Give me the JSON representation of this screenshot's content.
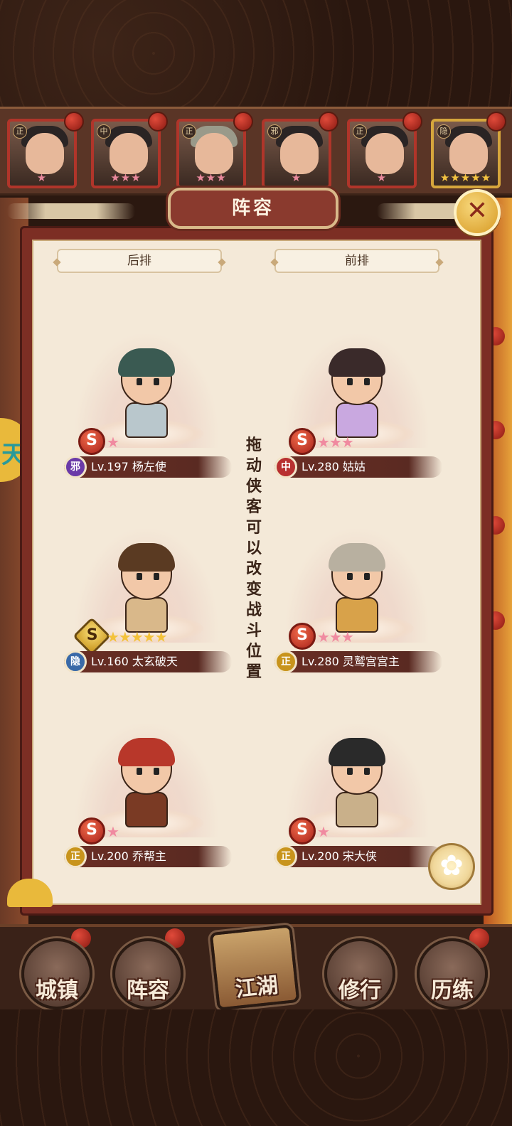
{
  "title": "阵容",
  "columns": {
    "back": "后排",
    "front": "前排"
  },
  "hint": "拖动侠客可以改变战斗位置",
  "roster_strip": [
    {
      "faction": "正",
      "stars": "★",
      "star_color": "pink"
    },
    {
      "faction": "中",
      "stars": "★★★",
      "star_color": "pink"
    },
    {
      "faction": "正",
      "stars": "★★★",
      "star_color": "pink"
    },
    {
      "faction": "邪",
      "stars": "★",
      "star_color": "pink"
    },
    {
      "faction": "正",
      "stars": "★",
      "star_color": "pink"
    },
    {
      "faction": "隐",
      "stars": "★★★★★",
      "star_color": "gold"
    }
  ],
  "heroes": [
    {
      "faction": "邪",
      "faction_color": "#6a3aa8",
      "level_name": "Lv.197 杨左使",
      "rank": "S",
      "rank_style": "red",
      "stars": "★",
      "star_color": "pink",
      "hair": "#3a5a52",
      "outfit": "#b9c7cc"
    },
    {
      "faction": "中",
      "faction_color": "#b83030",
      "level_name": "Lv.280 姑姑",
      "rank": "S",
      "rank_style": "red",
      "stars": "★★★",
      "star_color": "pink",
      "hair": "#3a2a2a",
      "outfit": "#c9a8e0"
    },
    {
      "faction": "隐",
      "faction_color": "#3a6aa8",
      "level_name": "Lv.160 太玄破天",
      "rank": "S",
      "rank_style": "gold",
      "stars": "★★★★★",
      "star_color": "gold",
      "hair": "#5a3a22",
      "outfit": "#d9b88a"
    },
    {
      "faction": "正",
      "faction_color": "#c8941c",
      "level_name": "Lv.280 灵鹫宫宫主",
      "rank": "S",
      "rank_style": "red",
      "stars": "★★★",
      "star_color": "pink",
      "hair": "#b8b0a0",
      "outfit": "#d8a24a"
    },
    {
      "faction": "正",
      "faction_color": "#c8941c",
      "level_name": "Lv.200 乔帮主",
      "rank": "S",
      "rank_style": "red",
      "stars": "★",
      "star_color": "pink",
      "hair": "#b8372a",
      "outfit": "#7a3a24"
    },
    {
      "faction": "正",
      "faction_color": "#c8941c",
      "level_name": "Lv.200 宋大侠",
      "rank": "S",
      "rank_style": "red",
      "stars": "★",
      "star_color": "pink",
      "hair": "#2a2a2a",
      "outfit": "#c9b08a"
    }
  ],
  "nav": [
    {
      "label": "城镇"
    },
    {
      "label": "阵容"
    },
    {
      "label": "江湖"
    },
    {
      "label": "修行"
    },
    {
      "label": "历练"
    }
  ],
  "icons": {
    "close": "close-icon",
    "flower": "flower-icon",
    "side_tab": "天"
  },
  "colors": {
    "panel": "#7c2e24",
    "parchment": "#f4e9d8",
    "accent_gold": "#e9b93b"
  }
}
